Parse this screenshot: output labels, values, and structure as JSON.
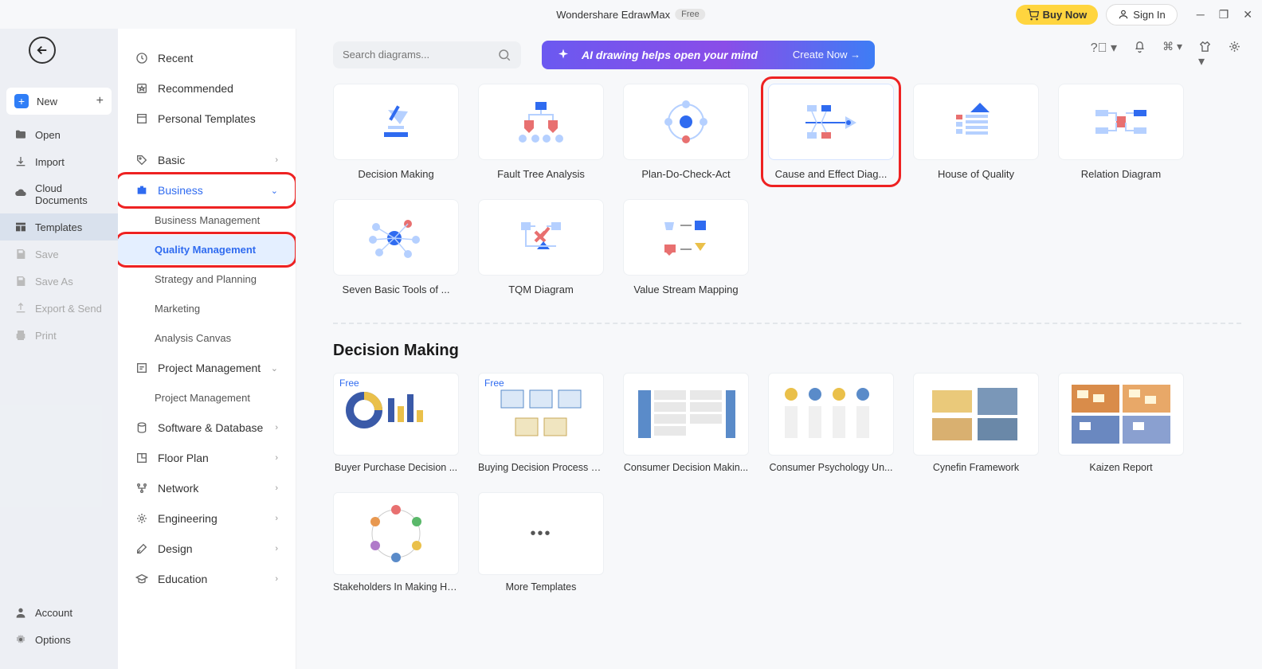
{
  "titlebar": {
    "app_name": "Wondershare EdrawMax",
    "badge": "Free",
    "buy": "Buy Now",
    "signin": "Sign In"
  },
  "left_sidebar": {
    "new": "New",
    "open": "Open",
    "import": "Import",
    "cloud": "Cloud Documents",
    "templates": "Templates",
    "save": "Save",
    "saveas": "Save As",
    "export": "Export & Send",
    "print": "Print",
    "account": "Account",
    "options": "Options"
  },
  "categories": {
    "recent": "Recent",
    "recommended": "Recommended",
    "personal": "Personal Templates",
    "basic": "Basic",
    "business": "Business",
    "business_subs": {
      "bm": "Business Management",
      "qm": "Quality Management",
      "sp": "Strategy and Planning",
      "mk": "Marketing",
      "ac": "Analysis Canvas"
    },
    "project_mgmt": "Project Management",
    "project_mgmt_sub": "Project Management",
    "software": "Software & Database",
    "floor": "Floor Plan",
    "network": "Network",
    "engineering": "Engineering",
    "design": "Design",
    "education": "Education"
  },
  "search": {
    "placeholder": "Search diagrams..."
  },
  "ai_banner": {
    "text": "AI drawing helps open your mind",
    "cta": "Create Now  →"
  },
  "diagram_cards": [
    {
      "label": "Decision Making"
    },
    {
      "label": "Fault Tree Analysis"
    },
    {
      "label": "Plan-Do-Check-Act"
    },
    {
      "label": "Cause and Effect Diag..."
    },
    {
      "label": "House of Quality"
    },
    {
      "label": "Relation Diagram"
    },
    {
      "label": "Seven Basic Tools of ..."
    },
    {
      "label": "TQM Diagram"
    },
    {
      "label": "Value Stream Mapping"
    }
  ],
  "section": {
    "title": "Decision Making"
  },
  "template_cards": [
    {
      "label": "Buyer Purchase Decision ...",
      "free": true
    },
    {
      "label": "Buying Decision Process O...",
      "free": true
    },
    {
      "label": "Consumer Decision Makin..."
    },
    {
      "label": "Consumer Psychology Un..."
    },
    {
      "label": "Cynefin Framework"
    },
    {
      "label": "Kaizen Report"
    },
    {
      "label": "Stakeholders In Making He..."
    },
    {
      "label": "More Templates",
      "more": true
    }
  ],
  "free_tag": "Free"
}
